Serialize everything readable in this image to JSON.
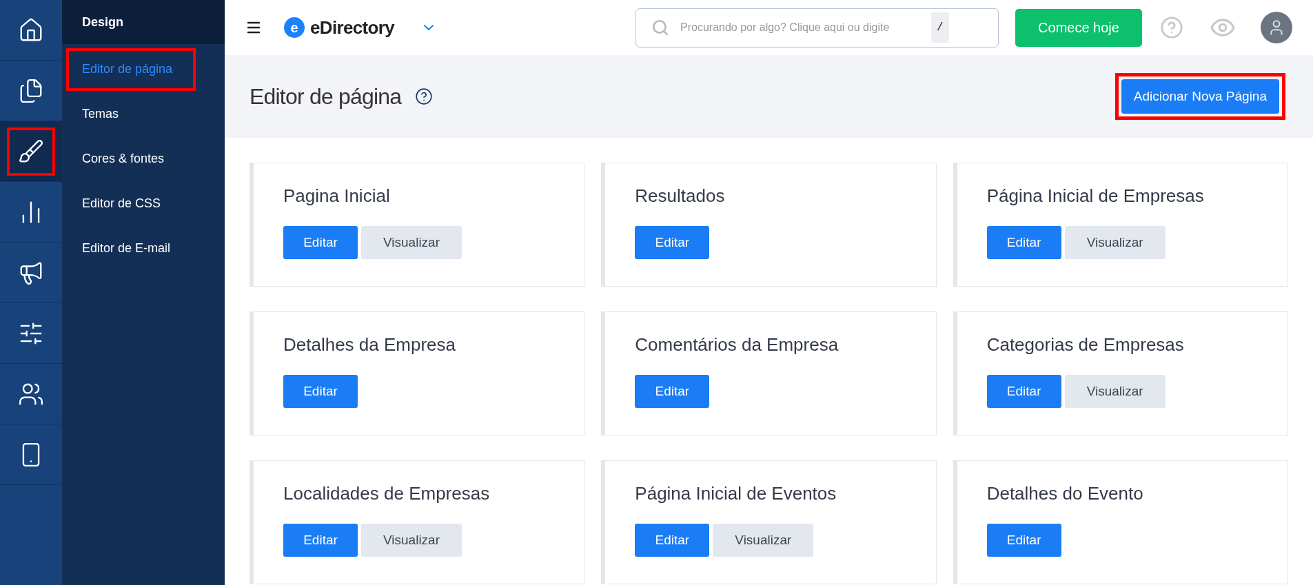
{
  "rail": [
    {
      "selected": false,
      "highlighted": false
    },
    {
      "selected": false,
      "highlighted": false
    },
    {
      "selected": true,
      "highlighted": true
    },
    {
      "selected": false,
      "highlighted": false
    },
    {
      "selected": false,
      "highlighted": false
    },
    {
      "selected": false,
      "highlighted": false
    },
    {
      "selected": false,
      "highlighted": false
    },
    {
      "selected": false,
      "highlighted": false
    }
  ],
  "submenu": {
    "title": "Design",
    "items": [
      {
        "label": "Editor de página",
        "selected": true,
        "highlighted": true
      },
      {
        "label": "Temas",
        "selected": false,
        "highlighted": false
      },
      {
        "label": "Cores & fontes",
        "selected": false,
        "highlighted": false
      },
      {
        "label": "Editor de CSS",
        "selected": false,
        "highlighted": false
      },
      {
        "label": "Editor de E-mail",
        "selected": false,
        "highlighted": false
      }
    ]
  },
  "topbar": {
    "logo": "eDirectory",
    "logo_mark": "e",
    "search": {
      "placeholder": "Procurando por algo? Clique aqui ou digite",
      "shortcut": "/"
    },
    "cta": "Comece hoje"
  },
  "page": {
    "title": "Editor de página",
    "add_button": {
      "label": "Adicionar Nova Página",
      "highlighted": true
    }
  },
  "cards": [
    {
      "title": "Pagina Inicial",
      "buttons": [
        {
          "kind": "primary",
          "label": "Editar"
        },
        {
          "kind": "secondary",
          "label": "Visualizar"
        }
      ]
    },
    {
      "title": "Resultados",
      "buttons": [
        {
          "kind": "primary",
          "label": "Editar"
        }
      ]
    },
    {
      "title": "Página Inicial de Empresas",
      "buttons": [
        {
          "kind": "primary",
          "label": "Editar"
        },
        {
          "kind": "secondary",
          "label": "Visualizar"
        }
      ]
    },
    {
      "title": "Detalhes da Empresa",
      "buttons": [
        {
          "kind": "primary",
          "label": "Editar"
        }
      ]
    },
    {
      "title": "Comentários da Empresa",
      "buttons": [
        {
          "kind": "primary",
          "label": "Editar"
        }
      ]
    },
    {
      "title": "Categorias de Empresas",
      "buttons": [
        {
          "kind": "primary",
          "label": "Editar"
        },
        {
          "kind": "secondary",
          "label": "Visualizar"
        }
      ]
    },
    {
      "title": "Localidades de Empresas",
      "buttons": [
        {
          "kind": "primary",
          "label": "Editar"
        },
        {
          "kind": "secondary",
          "label": "Visualizar"
        }
      ]
    },
    {
      "title": "Página Inicial de Eventos",
      "buttons": [
        {
          "kind": "primary",
          "label": "Editar"
        },
        {
          "kind": "secondary",
          "label": "Visualizar"
        }
      ]
    },
    {
      "title": "Detalhes do Evento",
      "buttons": [
        {
          "kind": "primary",
          "label": "Editar"
        }
      ]
    }
  ]
}
